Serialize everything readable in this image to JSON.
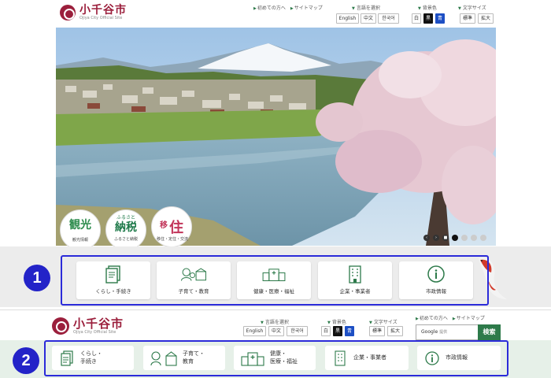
{
  "site": {
    "name": "小千谷市",
    "subtitle": "Ojiya City Official Site"
  },
  "top_links": [
    "初めての方へ",
    "サイトマップ"
  ],
  "language": {
    "label": "言語を選択",
    "options": [
      "English",
      "中文",
      "한국어"
    ]
  },
  "background_color": {
    "label": "背景色",
    "options": [
      "白",
      "黒",
      "青"
    ]
  },
  "font_size": {
    "label": "文字サイズ",
    "options": [
      "標準",
      "拡大"
    ]
  },
  "hero_badges": [
    {
      "big": "観光",
      "small": "観光情報",
      "color": "#2a8a4a"
    },
    {
      "big": "納税",
      "small": "ふるさと納税",
      "color": "#1f7a4a",
      "top": "ふるさと"
    },
    {
      "big": "住",
      "small": "移住・定住・交流",
      "color": "#c2355a",
      "top": "移"
    }
  ],
  "slider_controls": [
    "‹",
    "›",
    "■"
  ],
  "categories": [
    {
      "label": "くらし・手続き",
      "icon": "document-icon"
    },
    {
      "label": "子育て・教育",
      "icon": "family-school-icon"
    },
    {
      "label": "健康・医療・福祉",
      "icon": "hospital-icon"
    },
    {
      "label": "企業・事業者",
      "icon": "office-building-icon"
    },
    {
      "label": "市政情報",
      "icon": "info-icon"
    }
  ],
  "categories_compact": [
    {
      "label": "くらし・\n手続き",
      "icon": "document-icon"
    },
    {
      "label": "子育て・\n教育",
      "icon": "family-school-icon"
    },
    {
      "label": "健康・\n医療・福祉",
      "icon": "hospital-icon"
    },
    {
      "label": "企業・事業者",
      "icon": "office-building-icon"
    },
    {
      "label": "市政情報",
      "icon": "info-icon"
    }
  ],
  "search": {
    "placeholder": "Google",
    "placeholder_sub": "提供",
    "button": "検索"
  },
  "annotations": [
    "1",
    "2"
  ],
  "colors": {
    "brand": "#9b1f3c",
    "green": "#2d7a4a",
    "annotation": "#2323c8"
  }
}
